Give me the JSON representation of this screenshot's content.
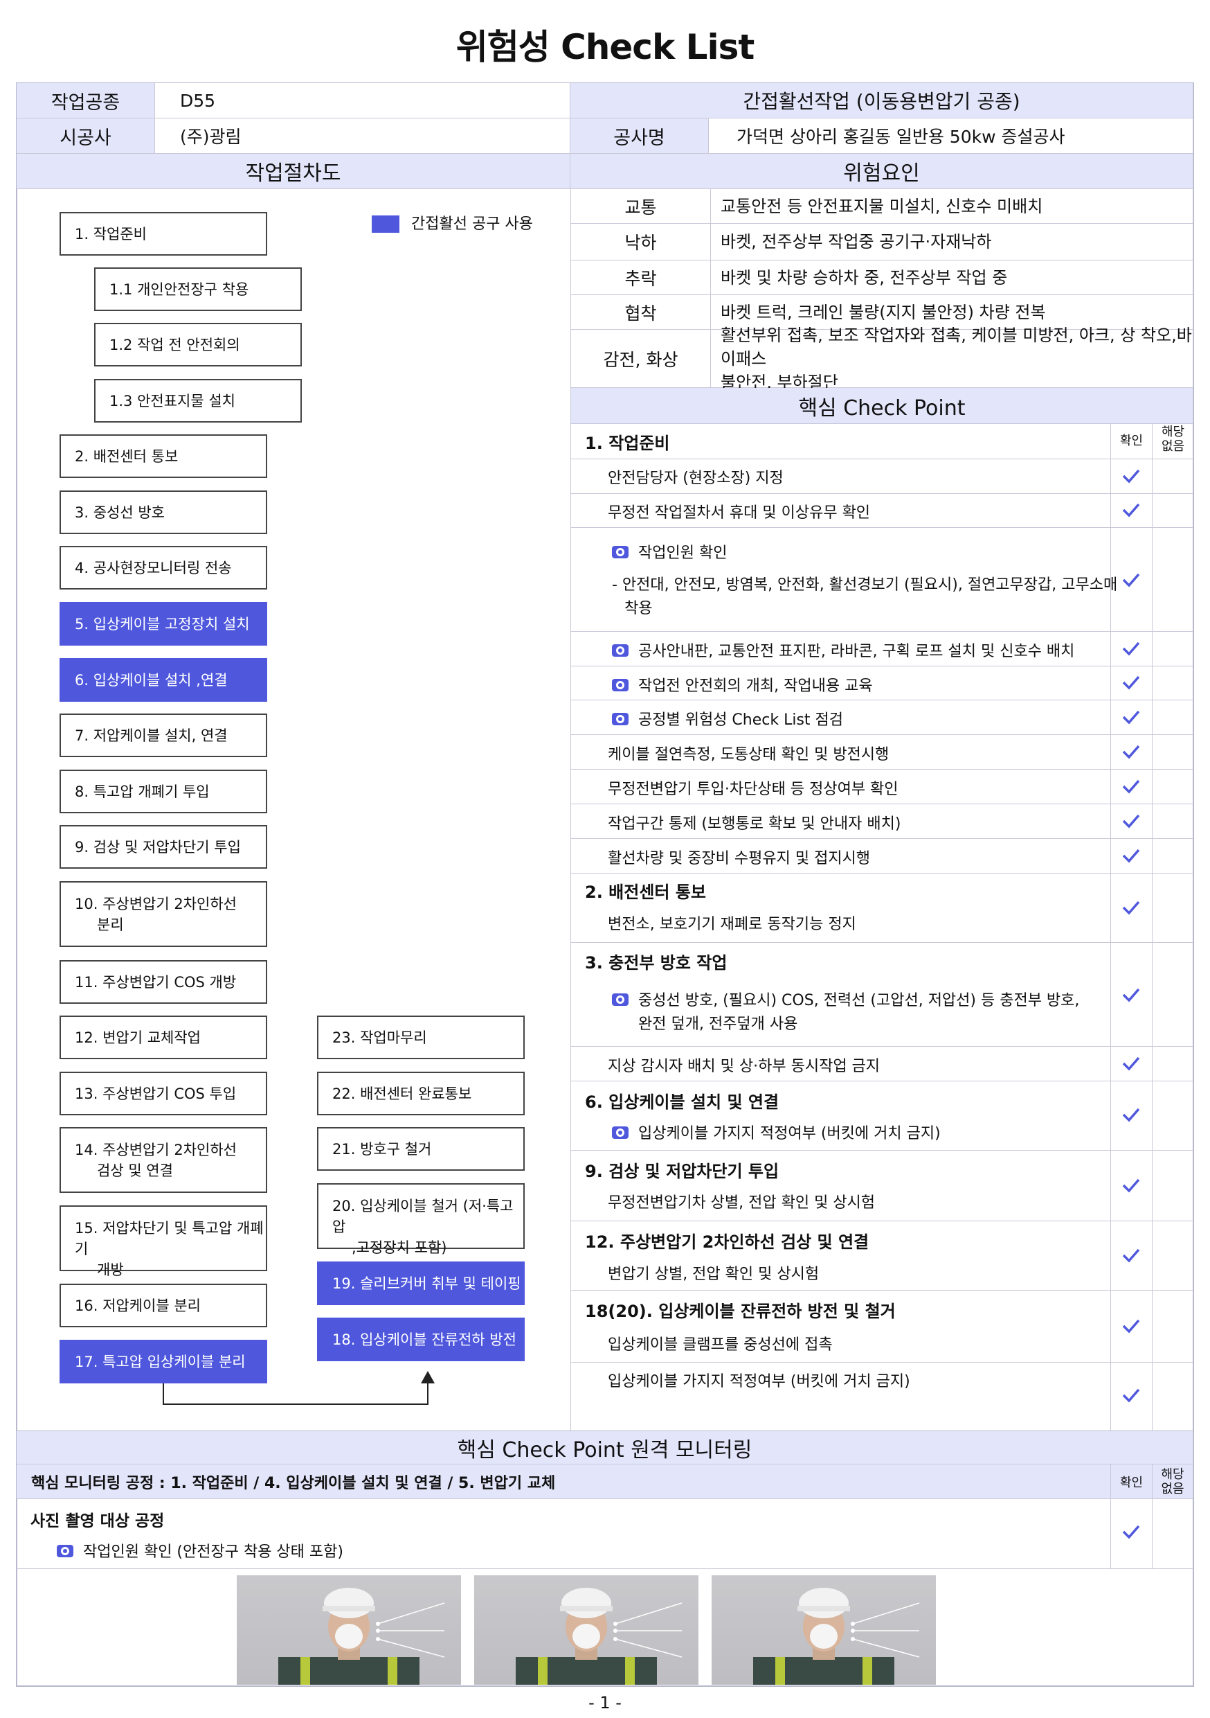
{
  "title": "위험성 Check List",
  "header": {
    "work_type_label": "작업공종",
    "work_type_value": "D55",
    "category": "간접활선작업 (이동용변압기 공종)",
    "contractor_label": "시공사",
    "contractor_value": "(주)광림",
    "project_label": "공사명",
    "project_value": "가덕면 상아리 홍길동 일반용 50kw 증설공사"
  },
  "procedure": {
    "title": "작업절차도",
    "legend": "간접활선 공구 사용",
    "steps": [
      "1. 작업준비",
      "1.1 개인안전장구 착용",
      "1.2 작업 전 안전회의",
      "1.3 안전표지물 설치",
      "2. 배전센터 통보",
      "3. 중성선 방호",
      "4. 공사현장모니터링 전송",
      "5. 입상케이블 고정장치 설치",
      "6. 입상케이블 설치 ,연결",
      "7. 저압케이블 설치, 연결",
      "8. 특고압 개폐기 투입",
      "9. 검상 및 저압차단기 투입",
      "10. 주상변압기 2차인하선",
      "분리",
      "11. 주상변압기 COS 개방",
      "12. 변압기 교체작업",
      "13. 주상변압기 COS 투입",
      "14. 주상변압기 2차인하선",
      "검상 및 연결",
      "15. 저압차단기 및 특고압 개폐기",
      "개방",
      "16. 저압케이블 분리",
      "17. 특고압 입상케이블 분리",
      "23. 작업마무리",
      "22. 배전센터 완료통보",
      "21. 방호구 철거",
      "20. 입상케이블 철거 (저·특고압",
      ",고정장치 포함)",
      "19. 슬리브커버 취부 및 테이핑",
      "18. 입상케이블 잔류전하 방전"
    ]
  },
  "hazards": {
    "title": "위험요인",
    "rows": [
      {
        "label": "교통",
        "text": "교통안전 등 안전표지물 미설치, 신호수 미배치"
      },
      {
        "label": "낙하",
        "text": "바켓, 전주상부 작업중 공기구·자재낙하"
      },
      {
        "label": "추락",
        "text": "바켓 및 차량 승하차 중, 전주상부 작업 중"
      },
      {
        "label": "협착",
        "text": "바켓 트럭, 크레인 불량(지지 불안정) 차량 전복"
      },
      {
        "label": "감전, 화상",
        "text": "활선부위 접촉, 보조 작업자와 접촉, 케이블 미방전, 아크, 상 착오,바이패스",
        "text2": "불안전, 부하절단"
      }
    ]
  },
  "checkpoint": {
    "title": "핵심 Check Point",
    "confirm": "확인",
    "na_1": "해당",
    "na_2": "없음",
    "sec1": "1. 작업준비",
    "i1": "안전담당자 (현장소장) 지정",
    "i2": "무정전 작업절차서 휴대 및 이상유무 확인",
    "i3": "작업인원 확인",
    "i3a": "- 안전대, 안전모, 방염복, 안전화, 활선경보기 (필요시), 절연고무장갑, 고무소매",
    "i3b": "착용",
    "i4": "공사안내판, 교통안전 표지판, 라바콘, 구획 로프 설치 및 신호수 배치",
    "i5": "작업전 안전회의 개최, 작업내용 교육",
    "i6": "공정별 위험성 Check List 점검",
    "i7": "케이블 절연측정, 도통상태 확인 및 방전시행",
    "i8": "무정전변압기 투입·차단상태 등 정상여부 확인",
    "i9": "작업구간 통제 (보행통로 확보 및 안내자 배치)",
    "i10": "활선차량 및 중장비 수평유지 및 접지시행",
    "sec2": "2. 배전센터 통보",
    "i11": "변전소, 보호기기 재폐로 동작기능 정지",
    "sec3": "3. 충전부 방호 작업",
    "i12a": "중성선 방호, (필요시) COS, 전력선 (고압선, 저압선) 등  충전부 방호,",
    "i12b": "완전 덮개, 전주덮개 사용",
    "i13": "지상 감시자 배치 및 상·하부 동시작업 금지",
    "sec6": "6. 입상케이블 설치 및 연결",
    "i14": "입상케이블 가지지 적정여부 (버킷에 거치 금지)",
    "sec9": "9. 검상 및 저압차단기 투입",
    "i15": "무정전변압기차 상별, 전압 확인 및 상시험",
    "sec12": "12. 주상변압기 2차인하선 검상 및 연결",
    "i16": "변압기 상별, 전압 확인 및 상시험",
    "sec18": "18(20). 입상케이블 잔류전하 방전 및 철거",
    "i17": "입상케이블 클램프를 중성선에 접촉",
    "i18": "입상케이블 가지지 적정여부 (버킷에 거치 금지)"
  },
  "monitoring": {
    "title": "핵심 Check Point 원격 모니터링",
    "process": "핵심 모니터링 공정 : 1. 작업준비  /  4. 입상케이블 설치 및 연결  /  5. 변압기 교체",
    "confirm": "확인",
    "na_1": "해당",
    "na_2": "없음",
    "photo_title": "사진 촬영 대상  공정",
    "photo_item": "작업인원 확인 (안전장구 착용 상태 포함)"
  },
  "page_number": "- 1 -",
  "colors": {
    "accent": "#4f58dd",
    "header_bg": "#e3e6fb",
    "check": "#4f58dd"
  }
}
